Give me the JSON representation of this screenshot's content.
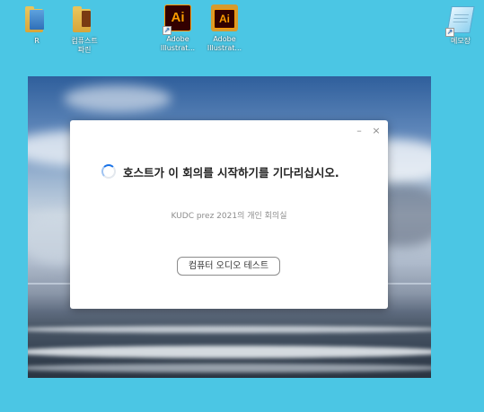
{
  "desktop": {
    "icons": [
      {
        "label": "R"
      },
      {
        "label": "컴퓨스트\n파린"
      },
      {
        "label": "Adobe\nIllustrat..."
      },
      {
        "label": "Adobe\nIllustrat..."
      },
      {
        "label": "메모장"
      }
    ],
    "ai_glyph": "Ai",
    "shortcut_glyph": "↗"
  },
  "dialog": {
    "minimize_glyph": "–",
    "close_glyph": "×",
    "wait_message": "호스트가 이 회의를 시작하기를 기다리십시오.",
    "meeting_room": "KUDC prez 2021의 개인 회의실",
    "test_audio_button": "컴퓨터 오디오 테스트"
  },
  "colors": {
    "desktop_bg": "#4bc6e4",
    "spinner_accent": "#1a73e8"
  }
}
